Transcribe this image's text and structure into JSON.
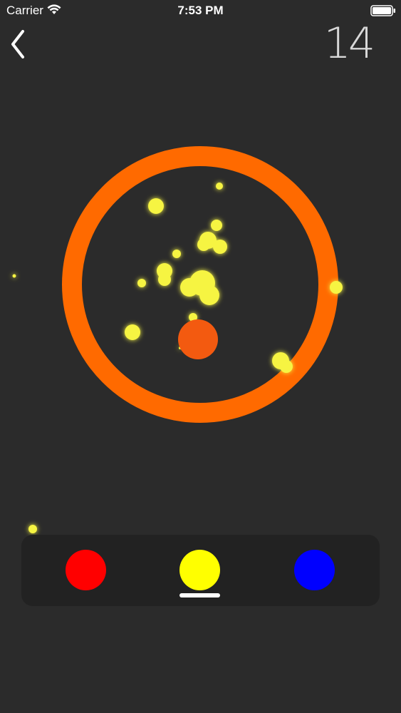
{
  "status_bar": {
    "carrier": "Carrier",
    "time": "7:53 PM",
    "icons": [
      "wifi-icon",
      "battery-icon"
    ]
  },
  "header": {
    "back_icon": "chevron-left-icon",
    "score": "14"
  },
  "game": {
    "ring_color": "#ff6a00",
    "core_color": "#f35a10",
    "particle_color": "#f6f442",
    "background_color": "#2b2b2b"
  },
  "controls": {
    "colors": [
      {
        "name": "red",
        "hex": "#ff0000"
      },
      {
        "name": "yellow",
        "hex": "#ffff00"
      },
      {
        "name": "blue",
        "hex": "#0000ff"
      }
    ],
    "selected": "yellow"
  }
}
